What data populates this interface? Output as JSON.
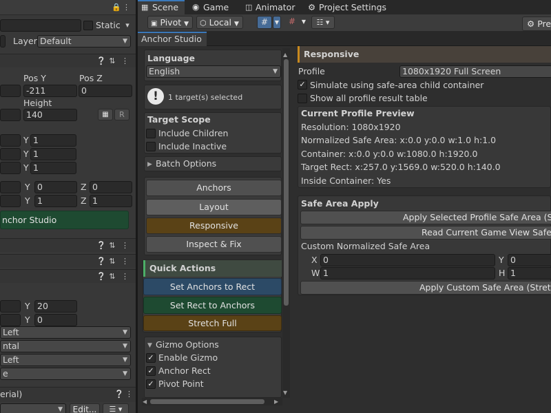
{
  "inspector": {
    "static_label": "Static",
    "layer_label": "Layer",
    "layer_value": "Default",
    "rect_headers": {
      "pos_y": "Pos Y",
      "pos_z": "Pos Z",
      "height": "Height"
    },
    "pos_y_value": "-211",
    "pos_z_value": "0",
    "height_value": "140",
    "r_button": "R",
    "scale_rows": [
      {
        "axis": "Y",
        "value": "1"
      },
      {
        "axis": "Y",
        "value": "1"
      },
      {
        "axis": "Y",
        "value": "1"
      }
    ],
    "pivot_row": {
      "y_label": "Y",
      "y_value": "0",
      "z_label": "Z",
      "z_value": "0"
    },
    "rotation_row": {
      "y_label": "Y",
      "y_value": "1",
      "z_label": "Z",
      "z_value": "1"
    },
    "anchor_studio_button": "nchor Studio",
    "spacing_rows": [
      {
        "axis": "Y",
        "value": "20"
      },
      {
        "axis": "Y",
        "value": "0"
      }
    ],
    "dropdowns": [
      "Left",
      "ntal",
      "Left",
      "e"
    ],
    "material_label": "erial)",
    "edit_button": "Edit..."
  },
  "tabs": {
    "scene": "Scene",
    "game": "Game",
    "animator": "Animator",
    "project_settings": "Project Settings"
  },
  "toolbar": {
    "pivot": "Pivot",
    "local": "Local",
    "preview_button": "Pre"
  },
  "panel": {
    "tab_title": "Anchor Studio",
    "language_label": "Language",
    "language_value": "English",
    "selection_info": "1 target(s) selected",
    "target_scope_title": "Target Scope",
    "include_children": "Include Children",
    "include_inactive": "Include Inactive",
    "batch_options": "Batch Options",
    "mode_buttons": [
      "Anchors",
      "Layout",
      "Responsive",
      "Inspect & Fix"
    ],
    "quick_actions_title": "Quick Actions",
    "quick_actions": [
      "Set Anchors to Rect",
      "Set Rect to Anchors",
      "Stretch Full"
    ],
    "gizmo_options_title": "Gizmo Options",
    "gizmo_items": [
      {
        "label": "Enable Gizmo",
        "checked": "✓"
      },
      {
        "label": "Anchor Rect",
        "checked": "✓"
      },
      {
        "label": "Pivot Point",
        "checked": "✓"
      }
    ]
  },
  "responsive": {
    "title": "Responsive",
    "profile_label": "Profile",
    "profile_value": "1080x1920 Full Screen",
    "simulate_label": "Simulate using safe-area child container",
    "show_all_label": "Show all profile result table",
    "preview_title": "Current Profile Preview",
    "resolution": "Resolution: 1080x1920",
    "normalized_safe_area": "Normalized Safe Area: x:0.0 y:0.0 w:1.0 h:1.0",
    "container": "Container: x:0.0 y:0.0 w:1080.0 h:1920.0",
    "target_rect": "Target Rect: x:257.0 y:1569.0 w:520.0 h:140.0",
    "inside_container": "Inside Container: Yes",
    "safe_area_title": "Safe Area Apply",
    "apply_selected_button": "Apply Selected Profile Safe Area (Stre",
    "read_current_button": "Read Current Game View Safe Ar",
    "custom_label": "Custom Normalized Safe Area",
    "x_label": "X",
    "x_value": "0",
    "y_label": "Y",
    "y_value": "0",
    "w_label": "W",
    "w_value": "1",
    "h_label": "H",
    "h_value": "1",
    "apply_custom_button": "Apply Custom Safe Area (Stretch I"
  },
  "colors": {
    "responsive_accent": "#c98a1e",
    "quick_actions_accent": "#4caf67",
    "blue_button": "#2c4a66",
    "green_button": "#1e4a31",
    "orange_button": "#5a4216"
  }
}
